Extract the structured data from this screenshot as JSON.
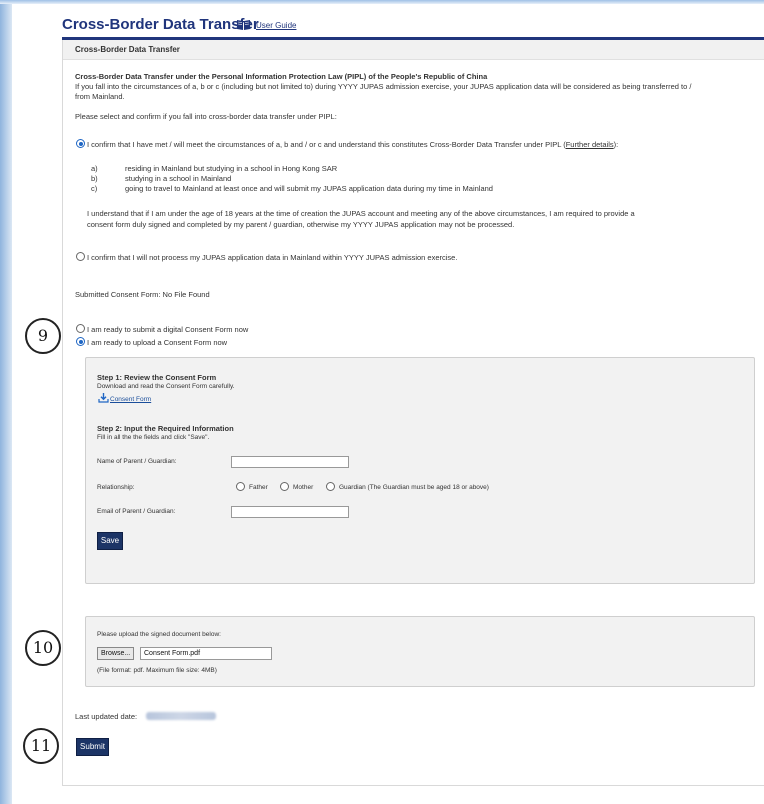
{
  "header": {
    "title": "Cross-Border Data Transfer",
    "guide_link": "User Guide",
    "guide_icon": "book-icon"
  },
  "panel": {
    "title": "Cross-Border Data Transfer"
  },
  "intro": {
    "heading": "Cross-Border Data Transfer under the Personal Information Protection Law (PIPL) of the People's Republic of China",
    "line1": "If you fall into the circumstances of a, b or c (including but not limited to) during YYYY JUPAS admission exercise, your JUPAS application data will be considered as being transferred to /",
    "line2": "from Mainland.",
    "prompt": "Please select and confirm if you fall into cross-border data transfer under PIPL:"
  },
  "option_a": {
    "text": "I confirm that I have met / will meet the circumstances of a, b and / or c and understand this constitutes Cross-Border Data Transfer under PIPL (",
    "link": "Further details",
    "text_end": "):",
    "selected": true
  },
  "circumstances": [
    {
      "letter": "a)",
      "text": "residing in Mainland but studying in a school in Hong Kong SAR"
    },
    {
      "letter": "b)",
      "text": "studying in a school in Mainland"
    },
    {
      "letter": "c)",
      "text": "going to travel to Mainland at least once and will submit my JUPAS application data during my time in Mainland"
    }
  ],
  "age_note": {
    "line1": "I understand that if I am under the age of 18 years at the time of creation the JUPAS account and meeting any of the above circumstances, I am required to provide a",
    "line2": "consent form duly signed and completed by my parent / guardian, otherwise my YYYY JUPAS application may not be processed."
  },
  "option_b": {
    "text": "I confirm that I will not process my JUPAS application data in Mainland within YYYY JUPAS admission exercise.",
    "selected": false
  },
  "submitted_consent": "Submitted Consent Form: No File Found",
  "consent_mode": {
    "digital": {
      "label": "I am ready to submit a digital Consent Form now",
      "selected": false
    },
    "upload": {
      "label": "I am ready to upload a Consent Form now",
      "selected": true
    }
  },
  "step1": {
    "title": "Step 1: Review the Consent Form",
    "desc": "Download and read the Consent Form carefully.",
    "download_link": "Consent Form",
    "download_icon": "download-icon"
  },
  "step2": {
    "title": "Step 2: Input the Required Information",
    "desc": "Fill in all the the fields and click \"Save\".",
    "parent_name_label": "Name of Parent / Guardian:",
    "parent_name_value": "",
    "relationship_label": "Relationship:",
    "relationship_options": [
      "Father",
      "Mother",
      "Guardian (The Guardian must be aged 18 or above)"
    ],
    "email_label": "Email of Parent / Guardian:",
    "email_value": "",
    "save_label": "Save"
  },
  "upload": {
    "instruction": "Please upload the signed document below:",
    "browse_label": "Browse...",
    "file_name": "Consent Form.pdf",
    "format_note": "(File format: pdf. Maximum file size: 4MB)"
  },
  "last_updated_label": "Last updated date:",
  "submit_label": "Submit",
  "annotations": [
    "9",
    "10",
    "11"
  ]
}
